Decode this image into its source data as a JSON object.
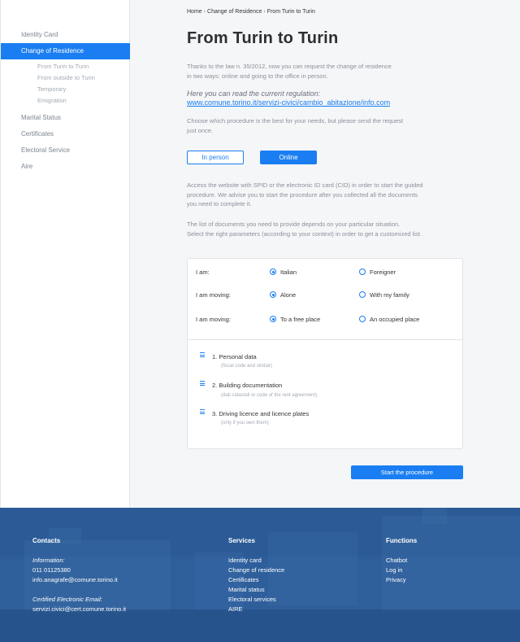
{
  "sidebar": {
    "items": [
      {
        "label": "Identity Card"
      },
      {
        "label": "Change of Residence"
      },
      {
        "label": "Marital Status"
      },
      {
        "label": "Certificates"
      },
      {
        "label": "Electoral Service"
      },
      {
        "label": "Aire"
      }
    ],
    "sub_items": [
      {
        "label": "From Turin to Turin"
      },
      {
        "label": "From outside to Turin"
      },
      {
        "label": "Temporary"
      },
      {
        "label": "Emigration"
      }
    ]
  },
  "breadcrumb": {
    "home": "Home",
    "section": "Change of Residence",
    "current": "From Turin to Turin",
    "separator": "›"
  },
  "page": {
    "title": "From Turin to Turin",
    "intro_1": "Thanks to the law n. 35/2012, now you can request the change of residence",
    "intro_2": "in two ways: online and going to the office in person.",
    "regulation_note": "Here you can read the current regulation:",
    "regulation_link": "www.comune.torino.it/servizi-civici/cambio_abitazione/info.com",
    "choose_1": "Choose which procedure is the best for your needs, but please send the request",
    "choose_2": "just once.",
    "in_person_label": "In person",
    "online_label": "Online",
    "access_1": "Access the website with SPID or the electronic ID card (CID) in order to start the guided",
    "access_2": "procedure. We advise you to start the procedure after you collected all the documents",
    "access_3": "you need to complete it.",
    "list_1": "The list of documents you need to provide depends on your particular situation.",
    "list_2": "Select the right parameters (according to your context) in order to get a customized list.",
    "start_label": "Start the procedure"
  },
  "options": [
    {
      "label": "I am:",
      "a": "Italian",
      "b": "Foreigner",
      "selected": "a"
    },
    {
      "label": "I am moving:",
      "a": "Alone",
      "b": "With my family",
      "selected": "a"
    },
    {
      "label": "I am moving:",
      "a": "To a free place",
      "b": "An occupied place",
      "selected": "a"
    }
  ],
  "documents": [
    {
      "title": "1. Personal data",
      "note": "(fiscal code and similar)"
    },
    {
      "title": "2. Building documentation",
      "note": "(dati catastali or code of the rent agreement)"
    },
    {
      "title": "3. Driving licence and licence plates",
      "note": "(only if you own them)"
    }
  ],
  "footer": {
    "contacts_heading": "Contacts",
    "info_label": "Information:",
    "phone": "011 01125380",
    "email": "info.anagrafe@comune.torino.it",
    "pec_label": "Certified Electronic Email:",
    "pec": "servizi.civici@cert.comune.torino.it",
    "services_heading": "Services",
    "services": [
      "Identity card",
      "Change of residence",
      "Certificates",
      "Marital status",
      "Electoral services",
      "AIRE"
    ],
    "functions_heading": "Functions",
    "functions": [
      "Chatbot",
      "Log in",
      "Privacy"
    ]
  },
  "colors": {
    "accent": "#1a7ef2",
    "footer_bg": "#2a5893",
    "sidebar_bg": "#ffffff",
    "page_bg": "#f5f6f8"
  }
}
